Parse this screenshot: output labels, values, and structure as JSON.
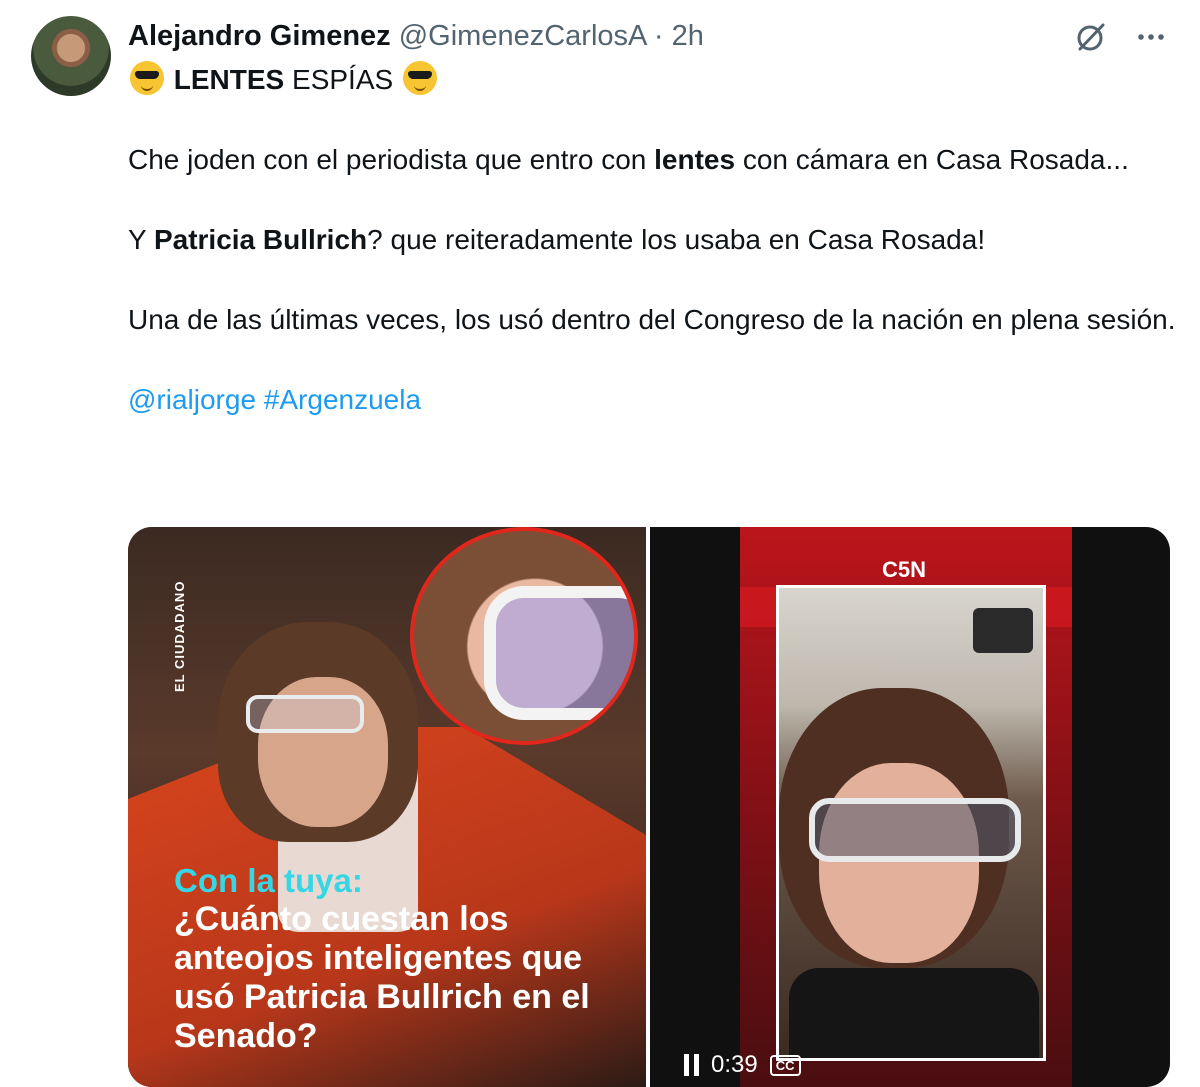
{
  "tweet": {
    "author_name": "Alejandro Gimenez",
    "author_handle": "@GimenezCarlosA",
    "separator": "·",
    "time": "2h",
    "lines": {
      "title_word": "LENTES",
      "title_rest": " ESPÍAS",
      "p1_a": "Che joden con el periodista que entro con ",
      "p1_b": "lentes",
      "p1_c": " con cámara en Casa Rosada...",
      "p2_a": "Y ",
      "p2_b": "Patricia Bullrich",
      "p2_c": "? que reiteradamente los usaba en Casa Rosada!",
      "p3": "Una de las últimas veces, los usó dentro del Congreso de la nación en plena sesión.",
      "mention": "@rialjorge",
      "hashtag": "#Argenzuela"
    }
  },
  "media": {
    "left": {
      "vertical_label": "EL CIUDADANO",
      "kicker": "Con la tuya:",
      "headline": "¿Cuánto cuestan los anteojos inteligentes que usó Patricia Bullrich en el Senado?"
    },
    "right": {
      "channel": "C5N",
      "time": "0:39",
      "cc": "CC"
    }
  },
  "icons": {
    "grok": "grok-icon",
    "more": "more-icon",
    "emoji": "sunglasses-emoji-icon",
    "pause": "pause-icon"
  },
  "colors": {
    "link": "#1d9bf0",
    "secondary": "#536471",
    "accent_cyan": "#35d6e5",
    "brand_red": "#e81b23"
  }
}
